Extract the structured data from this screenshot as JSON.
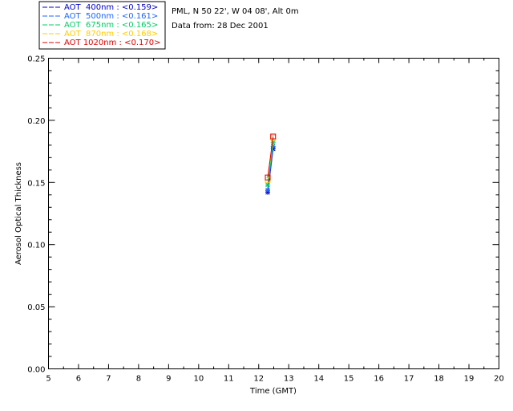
{
  "chart_data": {
    "type": "line",
    "title": "",
    "xlabel": "Time (GMT)",
    "ylabel": "Aerosol Optical Thickness",
    "xlim": [
      5,
      20
    ],
    "ylim": [
      0.0,
      0.25
    ],
    "x_ticks": [
      "5",
      "6",
      "7",
      "8",
      "9",
      "10",
      "11",
      "12",
      "13",
      "14",
      "15",
      "16",
      "17",
      "18",
      "19",
      "20"
    ],
    "y_ticks": [
      "0.00",
      "0.05",
      "0.10",
      "0.15",
      "0.20",
      "0.25"
    ],
    "grid": false,
    "legend_position": "top-left outside",
    "info_lines": [
      "PML, N 50 22', W 04 08', Alt 0m",
      "Data from: 28 Dec 2001"
    ],
    "series": [
      {
        "name": "AOT  400nm : <0.159>",
        "color": "#0000cc",
        "marker": "asterisk",
        "x": [
          12.3,
          12.48
        ],
        "y": [
          0.142,
          0.177
        ]
      },
      {
        "name": "AOT  500nm : <0.161>",
        "color": "#1a66ff",
        "marker": "asterisk",
        "x": [
          12.3,
          12.48
        ],
        "y": [
          0.144,
          0.179
        ]
      },
      {
        "name": "AOT  675nm : <0.165>",
        "color": "#00cc66",
        "marker": "asterisk",
        "x": [
          12.3,
          12.48
        ],
        "y": [
          0.148,
          0.182
        ]
      },
      {
        "name": "AOT  870nm : <0.168>",
        "color": "#ffcc00",
        "marker": "square",
        "x": [
          12.3,
          12.48
        ],
        "y": [
          0.152,
          0.186
        ]
      },
      {
        "name": "AOT 1020nm : <0.170>",
        "color": "#dd0000",
        "marker": "square",
        "x": [
          12.3,
          12.48
        ],
        "y": [
          0.154,
          0.187
        ]
      }
    ]
  }
}
